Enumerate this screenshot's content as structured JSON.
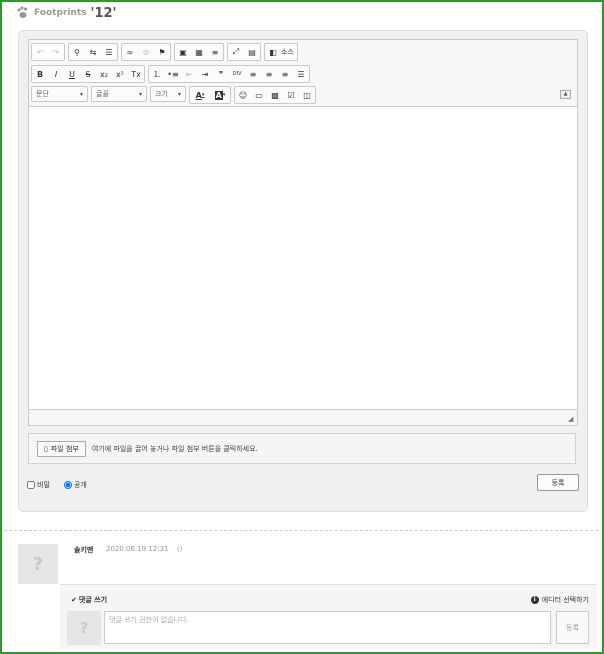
{
  "header": {
    "brand": "Footprints",
    "title": "'12'",
    "brand_icon": "paw-icon"
  },
  "editor": {
    "toolbar_row1": [
      "undo-icon",
      "redo-icon",
      "find-icon",
      "replace-icon",
      "select-all-icon",
      "link-icon",
      "unlink-icon",
      "anchor-icon",
      "image-icon",
      "table-icon",
      "hr-icon",
      "maximize-icon",
      "show-blocks-icon",
      "source-icon"
    ],
    "source_label": "소스",
    "toolbar_row2": {
      "bold": "B",
      "italic": "I",
      "underline": "U",
      "strike": "S",
      "subscript": "x₂",
      "superscript": "x²",
      "remove_format": "Tx",
      "blockquote": "❞",
      "div": "DIV"
    },
    "format_combo": "문단",
    "font_combo": "글꼴",
    "size_combo": "크기",
    "text_color": "A",
    "bg_color": "A",
    "collapse": "▲",
    "resize": "◢"
  },
  "attach": {
    "button": "파일 첨부",
    "hint": "여기에 파일을 끌어 놓거나 파일 첨부 버튼을 클릭하세요."
  },
  "options": {
    "secret_label": "비밀",
    "public_label": "공개"
  },
  "register_button": "등록",
  "comment": {
    "avatar": "?",
    "author": "솔키맨",
    "date": "2020.06.19 12:31",
    "paren": "()"
  },
  "reply": {
    "title": "댓글 쓰기",
    "editor_mode": "에디터 선택하기",
    "placeholder": "댓글 쓰기 권한이 없습니다.",
    "submit": "등록",
    "avatar": "?"
  },
  "colors": {
    "frame": "#2a9a2a",
    "panel": "#f0f0f0"
  }
}
